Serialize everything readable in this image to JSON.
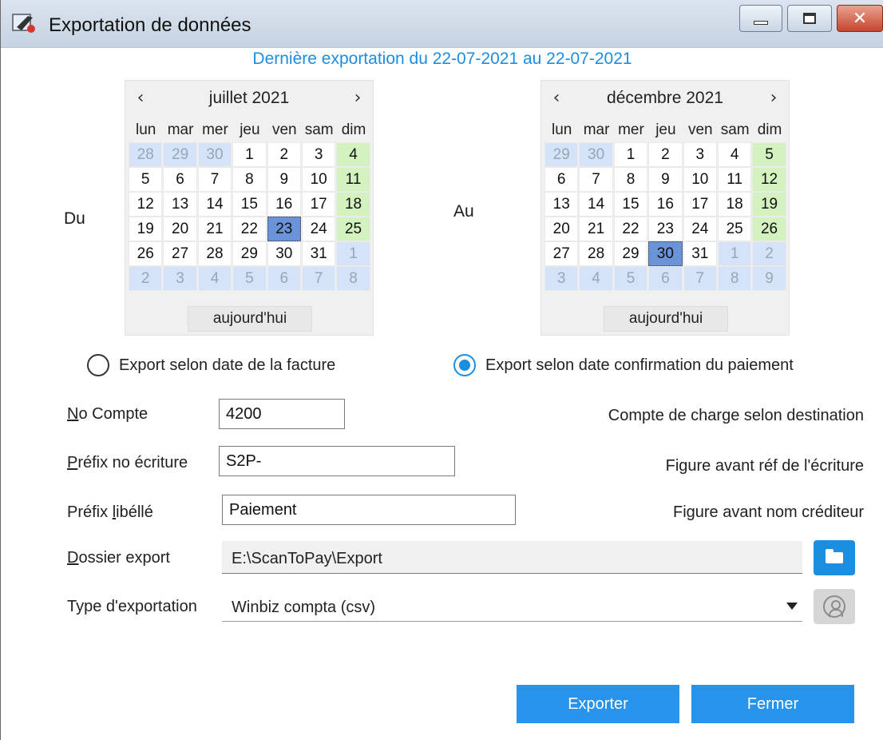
{
  "window": {
    "title": "Exportation de données",
    "close_glyph": "✕"
  },
  "last_export": "Dernière exportation du 22-07-2021 au 22-07-2021",
  "labels": {
    "du": "Du",
    "au": "Au"
  },
  "calendar_left": {
    "month": "juillet 2021",
    "prev": "‹",
    "next": "›",
    "dow": [
      "lun",
      "mar",
      "mer",
      "jeu",
      "ven",
      "sam",
      "dim"
    ],
    "days": [
      [
        "28",
        "o"
      ],
      [
        "29",
        "o"
      ],
      [
        "30",
        "o"
      ],
      [
        "1",
        "c"
      ],
      [
        "2",
        "c"
      ],
      [
        "3",
        "c"
      ],
      [
        "4",
        "s"
      ],
      [
        "5",
        "c"
      ],
      [
        "6",
        "c"
      ],
      [
        "7",
        "c"
      ],
      [
        "8",
        "c"
      ],
      [
        "9",
        "c"
      ],
      [
        "10",
        "c"
      ],
      [
        "11",
        "s"
      ],
      [
        "12",
        "c"
      ],
      [
        "13",
        "c"
      ],
      [
        "14",
        "c"
      ],
      [
        "15",
        "c"
      ],
      [
        "16",
        "c"
      ],
      [
        "17",
        "c"
      ],
      [
        "18",
        "s"
      ],
      [
        "19",
        "c"
      ],
      [
        "20",
        "c"
      ],
      [
        "21",
        "c"
      ],
      [
        "22",
        "c"
      ],
      [
        "23",
        "x"
      ],
      [
        "24",
        "c"
      ],
      [
        "25",
        "s"
      ],
      [
        "26",
        "c"
      ],
      [
        "27",
        "c"
      ],
      [
        "28",
        "c"
      ],
      [
        "29",
        "c"
      ],
      [
        "30",
        "c"
      ],
      [
        "31",
        "c"
      ],
      [
        "1",
        "o"
      ],
      [
        "2",
        "o"
      ],
      [
        "3",
        "o"
      ],
      [
        "4",
        "o"
      ],
      [
        "5",
        "o"
      ],
      [
        "6",
        "o"
      ],
      [
        "7",
        "o"
      ],
      [
        "8",
        "o"
      ]
    ],
    "today_label": "aujourd'hui"
  },
  "calendar_right": {
    "month": "décembre 2021",
    "prev": "‹",
    "next": "›",
    "dow": [
      "lun",
      "mar",
      "mer",
      "jeu",
      "ven",
      "sam",
      "dim"
    ],
    "days": [
      [
        "29",
        "o"
      ],
      [
        "30",
        "o"
      ],
      [
        "1",
        "c"
      ],
      [
        "2",
        "c"
      ],
      [
        "3",
        "c"
      ],
      [
        "4",
        "c"
      ],
      [
        "5",
        "s"
      ],
      [
        "6",
        "c"
      ],
      [
        "7",
        "c"
      ],
      [
        "8",
        "c"
      ],
      [
        "9",
        "c"
      ],
      [
        "10",
        "c"
      ],
      [
        "11",
        "c"
      ],
      [
        "12",
        "s"
      ],
      [
        "13",
        "c"
      ],
      [
        "14",
        "c"
      ],
      [
        "15",
        "c"
      ],
      [
        "16",
        "c"
      ],
      [
        "17",
        "c"
      ],
      [
        "18",
        "c"
      ],
      [
        "19",
        "s"
      ],
      [
        "20",
        "c"
      ],
      [
        "21",
        "c"
      ],
      [
        "22",
        "c"
      ],
      [
        "23",
        "c"
      ],
      [
        "24",
        "c"
      ],
      [
        "25",
        "c"
      ],
      [
        "26",
        "s"
      ],
      [
        "27",
        "c"
      ],
      [
        "28",
        "c"
      ],
      [
        "29",
        "c"
      ],
      [
        "30",
        "x"
      ],
      [
        "31",
        "c"
      ],
      [
        "1",
        "o"
      ],
      [
        "2",
        "o"
      ],
      [
        "3",
        "o"
      ],
      [
        "4",
        "o"
      ],
      [
        "5",
        "o"
      ],
      [
        "6",
        "o"
      ],
      [
        "7",
        "o"
      ],
      [
        "8",
        "o"
      ],
      [
        "9",
        "o"
      ]
    ],
    "today_label": "aujourd'hui"
  },
  "radio": {
    "invoice_date": "Export selon date de la facture",
    "payment_date": "Export selon date confirmation du paiement",
    "selected": "payment_date"
  },
  "form": {
    "account_label_u": "N",
    "account_label_rest": "o Compte",
    "account_value": "4200",
    "account_hint": "Compte de charge selon destination",
    "entry_prefix_label_u": "P",
    "entry_prefix_label_rest": "réfix no écriture",
    "entry_prefix_value": "S2P-",
    "entry_prefix_hint": "Figure avant réf de l'écriture",
    "label_prefix_label_pre": "Préfix ",
    "label_prefix_label_u": "l",
    "label_prefix_label_rest": "ibéllé",
    "label_prefix_value": "Paiement",
    "label_prefix_hint": "Figure avant nom créditeur",
    "folder_label_u": "D",
    "folder_label_rest": "ossier export",
    "folder_value": "E:\\ScanToPay\\Export",
    "type_label": "Type d'exportation",
    "type_value": "Winbiz compta (csv)"
  },
  "buttons": {
    "export": "Exporter",
    "close": "Fermer"
  },
  "colors": {
    "accent": "#1c8ee0",
    "button": "#2893ea",
    "sunday": "#d4f2bf",
    "other_month": "#d4e3f7",
    "selected_day": "#6a93d8"
  }
}
